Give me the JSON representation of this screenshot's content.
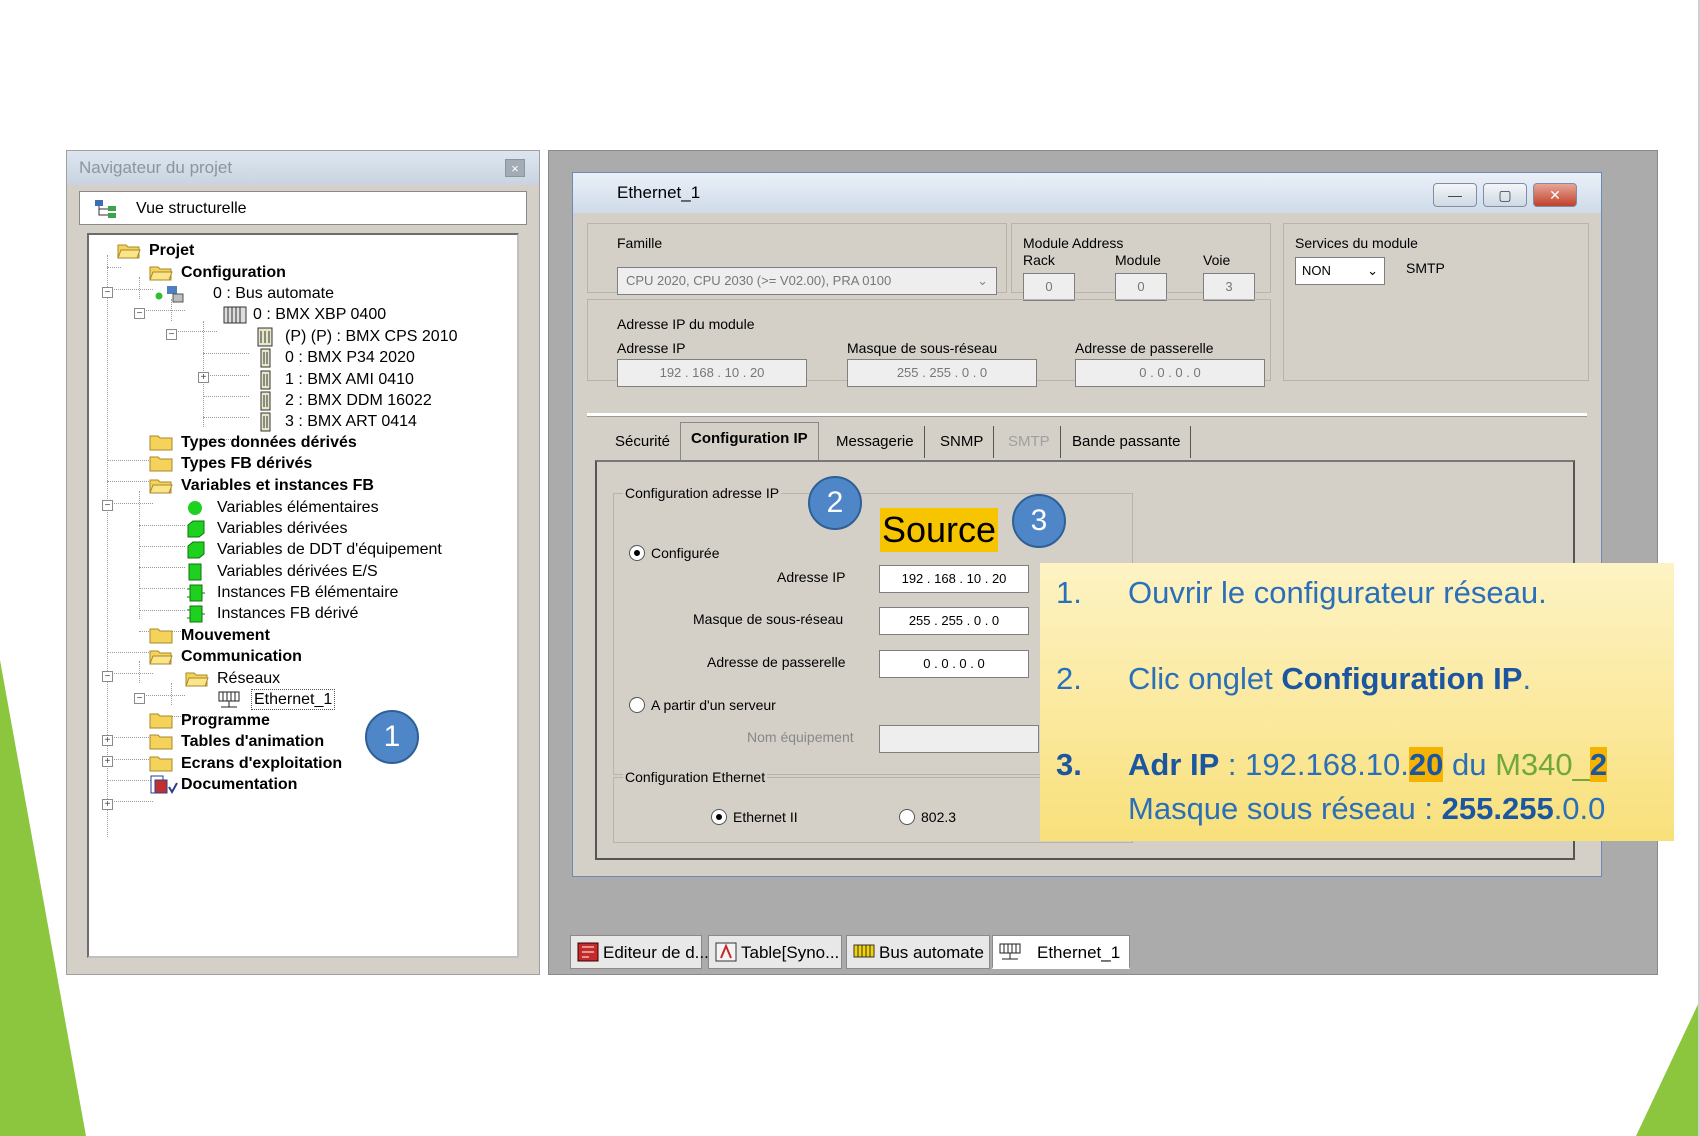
{
  "colors": {
    "accent": "#4e86c7",
    "note_bg": "#fbe89a",
    "highlight": "#f6b400",
    "green": "#8cc63f"
  },
  "navigator": {
    "title": "Navigateur du projet",
    "close": "×",
    "view_label": "Vue structurelle",
    "tree": {
      "project": "Projet",
      "configuration": "Configuration",
      "bus": "0 : Bus automate",
      "rack": "0 : BMX XBP 0400",
      "mod_cps": "(P) (P) : BMX CPS 2010",
      "mod_p34": "0 : BMX P34 2020",
      "mod_ami": "1 : BMX AMI 0410",
      "mod_ddm": "2 : BMX DDM 16022",
      "mod_art": "3 : BMX ART 0414",
      "types_donnees": "Types données dérivés",
      "types_fb": "Types FB dérivés",
      "variables": "Variables et instances FB",
      "var_elem": "Variables élémentaires",
      "var_der": "Variables dérivées",
      "var_ddt": "Variables de DDT d'équipement",
      "var_es": "Variables dérivées E/S",
      "inst_fb_elem": "Instances FB élémentaire",
      "inst_fb_der": "Instances FB dérivé",
      "mouvement": "Mouvement",
      "communication": "Communication",
      "reseaux": "Réseaux",
      "ethernet": "Ethernet_1",
      "programme": "Programme",
      "tables": "Tables d'animation",
      "ecrans": "Ecrans d'exploitation",
      "documentation": "Documentation"
    }
  },
  "window": {
    "title": "Ethernet_1",
    "minimize": "—",
    "maximize": "▢",
    "close": "✕",
    "famille_label": "Famille",
    "famille_value": "CPU 2020, CPU 2030 (>= V02.00), PRA 0100",
    "module_address_label": "Module Address",
    "rack_label": "Rack",
    "rack_value": "0",
    "module_label": "Module",
    "module_value": "0",
    "voie_label": "Voie",
    "voie_value": "3",
    "services_label": "Services du module",
    "services_value": "NON",
    "smtp_label": "SMTP",
    "ip_module_label": "Adresse IP du module",
    "ip_label": "Adresse IP",
    "ip_value": "192  .  168  .  10  .  20",
    "mask_label": "Masque de sous-réseau",
    "mask_value": "255  .  255  .  0  .  0",
    "gw_label": "Adresse de passerelle",
    "gw_value": "0  .  0  .  0  .  0",
    "tabs": [
      "Sécurité",
      "Configuration IP",
      "Messagerie",
      "SNMP",
      "SMTP",
      "Bande passante"
    ],
    "cfg_ip_group": "Configuration adresse IP",
    "configured_label": "Configurée",
    "ip2_label": "Adresse IP",
    "ip2_value": "192 . 168 . 10 . 20",
    "mask2_label": "Masque de sous-réseau",
    "mask2_value": "255 . 255 . 0 . 0",
    "gw2_label": "Adresse de passerelle",
    "gw2_value": "0 . 0 . 0 . 0",
    "server_label": "A partir d'un serveur",
    "equip_label": "Nom équipement",
    "eth_cfg_group": "Configuration Ethernet",
    "eth2_label": "Ethernet II",
    "eth8023_label": "802.3"
  },
  "taskbar": [
    "Editeur de d...",
    "Table[Syno...",
    "Bus automate",
    "Ethernet_1"
  ],
  "badges": [
    "1",
    "2",
    "3"
  ],
  "source_label": "Source",
  "note": {
    "s1_num": "1.",
    "s1_text": "Ouvrir le configurateur réseau.",
    "s2_num": "2.",
    "s2_pre": "Clic onglet ",
    "s2_bold": "Configuration IP",
    "s2_post": ".",
    "s3_num": "3.",
    "s3_bold": "Adr IP",
    "s3_a": " : 192.168.10.",
    "s3_hl": "20",
    "s3_b": " du ",
    "s3_c": "M340_",
    "s3_d": "2",
    "s3_line2_a": "Masque sous réseau : ",
    "s3_line2_bold": "255.255",
    "s3_line2_b": ".0.0"
  }
}
